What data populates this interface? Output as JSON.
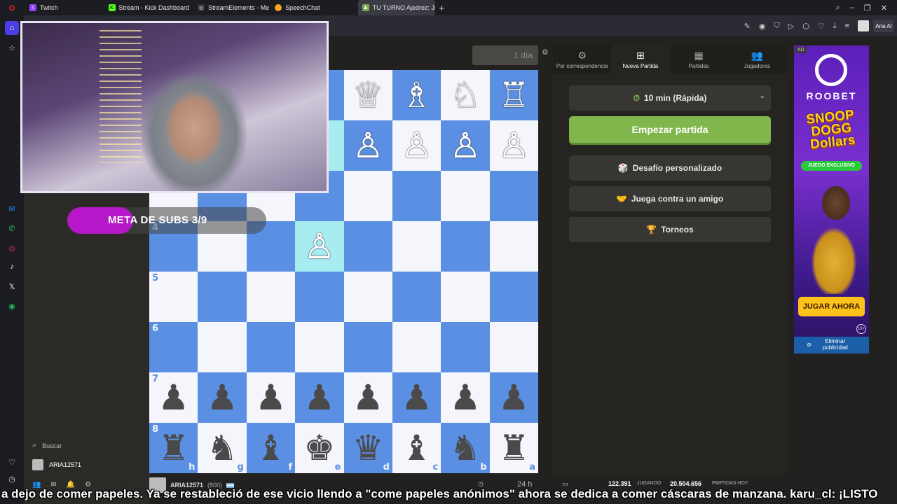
{
  "browser": {
    "tabs": [
      {
        "label": "Twitch",
        "color": "#9146ff",
        "glyph": "t"
      },
      {
        "label": "Stream - Kick Dashboard",
        "color": "#53fc18",
        "glyph": "K"
      },
      {
        "label": "StreamElements - Me",
        "color": "#333333",
        "glyph": "◎"
      },
      {
        "label": "SpeechChat",
        "color": "#f5a623",
        "glyph": "●"
      },
      {
        "label": "TU TURNO Ajedrez: Juank",
        "color": "#7fa650",
        "glyph": "♟"
      }
    ],
    "new_tab": "+",
    "ai_label": "Aria AI"
  },
  "overlay": {
    "subs_goal_label": "META DE SUBS 3/9",
    "subs_goal_progress": 0.33
  },
  "left_panel": {
    "search_label": "Buscar",
    "username": "ARIA12571"
  },
  "board": {
    "timer": "1 día",
    "rows": [
      [
        "",
        "",
        "",
        "♗",
        "♕",
        "♗",
        "♘",
        "♖"
      ],
      [
        "",
        "",
        "",
        "",
        "♙",
        "♙",
        "♙",
        "♙"
      ],
      [
        "",
        "",
        "",
        "",
        "",
        "",
        "",
        ""
      ],
      [
        "",
        "",
        "",
        "♙",
        "",
        "",
        "",
        ""
      ],
      [
        "",
        "",
        "",
        "",
        "",
        "",
        "",
        ""
      ],
      [
        "",
        "",
        "",
        "",
        "",
        "",
        "",
        ""
      ],
      [
        "♟",
        "♟",
        "♟",
        "♟",
        "♟",
        "♟",
        "♟",
        "♟"
      ],
      [
        "♜",
        "♞",
        "♝",
        "♚",
        "♛",
        "♝",
        "♞",
        "♜"
      ]
    ],
    "ranks": [
      "",
      "",
      "",
      "4",
      "5",
      "6",
      "7",
      "8"
    ],
    "files": [
      "h",
      "g",
      "f",
      "e",
      "d",
      "c",
      "b",
      "a"
    ],
    "highlights": [
      [
        1,
        3
      ],
      [
        3,
        3
      ]
    ],
    "opponent": "ARIA12571",
    "opponent_rating": "(800)",
    "bottom_time": "24 h"
  },
  "stats": {
    "playing_count": "122.391",
    "playing_label": "JUGANDO",
    "games_count": "20.504.656",
    "games_label": "PARTIDAS HOY"
  },
  "panel": {
    "tabs": [
      {
        "label": "Por correspondencia",
        "icon": "⚙"
      },
      {
        "label": "Nueva Partida",
        "icon": "⊞"
      },
      {
        "label": "Partidas",
        "icon": "▦"
      },
      {
        "label": "Jugadores",
        "icon": "👥"
      }
    ],
    "time_control": "10 min (Rápida)",
    "play_button": "Empezar partida",
    "custom_challenge": "Desafío personalizado",
    "play_friend": "Juega contra un amigo",
    "tournaments": "Torneos"
  },
  "ad": {
    "tag": "AD",
    "brand": "ROOBET",
    "game_title": "SNOOP DOGG Dollars",
    "badge": "JUEGO EXCLUSIVO",
    "cta": "JUGAR AHORA",
    "age": "18+",
    "remove": "Eliminar publicidad"
  },
  "caption": "a dejo de comer papeles. Ya se restableció de ese vicio llendo a \"come papeles anónimos\" ahora se dedica a comer cáscaras de manzana. karu_cl: ¡LISTO",
  "colors": {
    "board_dark": "#5a8fe3",
    "board_light": "#f4f6fb",
    "highlight": "#a6ecf0",
    "play_green": "#81b64c",
    "subs_purple": "#b617c8"
  }
}
